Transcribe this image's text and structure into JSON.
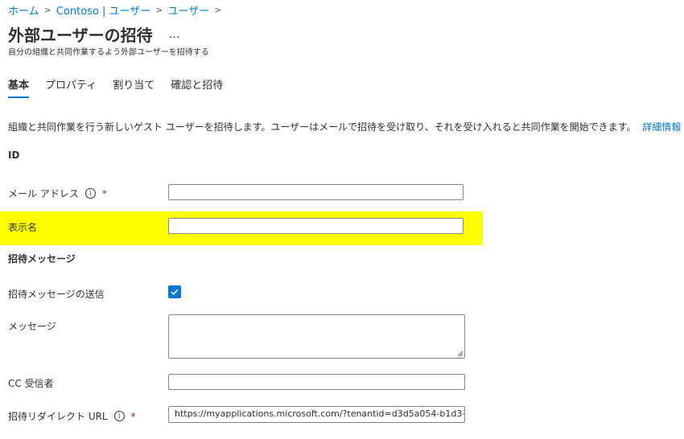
{
  "breadcrumb": {
    "items": [
      "ホーム",
      "Contoso | ユーザー",
      "ユーザー"
    ]
  },
  "header": {
    "title": "外部ユーザーの招待",
    "more": "…",
    "subtitle": "自分の組織と共同作業するよう外部ユーザーを招待する"
  },
  "tabs": [
    {
      "label": "基本",
      "active": true
    },
    {
      "label": "プロパティ",
      "active": false
    },
    {
      "label": "割り当て",
      "active": false
    },
    {
      "label": "確認と招待",
      "active": false
    }
  ],
  "description": {
    "text": "組織と共同作業を行う新しいゲスト ユーザーを招待します。ユーザーはメールで招待を受け取り、それを受け入れると共同作業を開始できます。",
    "link": "詳細情報"
  },
  "sections": {
    "identity": "ID",
    "invitation": "招待メッセージ"
  },
  "form": {
    "email_label": "メール アドレス",
    "email_value": "",
    "required_mark": "*",
    "display_name_label": "表示名",
    "display_name_value": "",
    "send_invite_label": "招待メッセージの送信",
    "send_invite_checked": true,
    "message_label": "メッセージ",
    "cc_label": "CC 受信者",
    "cc_value": "",
    "redirect_label": "招待リダイレクト URL",
    "redirect_value": "https://myapplications.microsoft.com/?tenantid=d3d5a054-b1d3-..."
  },
  "colors": {
    "accent": "#0078d4",
    "highlight": "#ffff00",
    "required": "#a4262c"
  }
}
